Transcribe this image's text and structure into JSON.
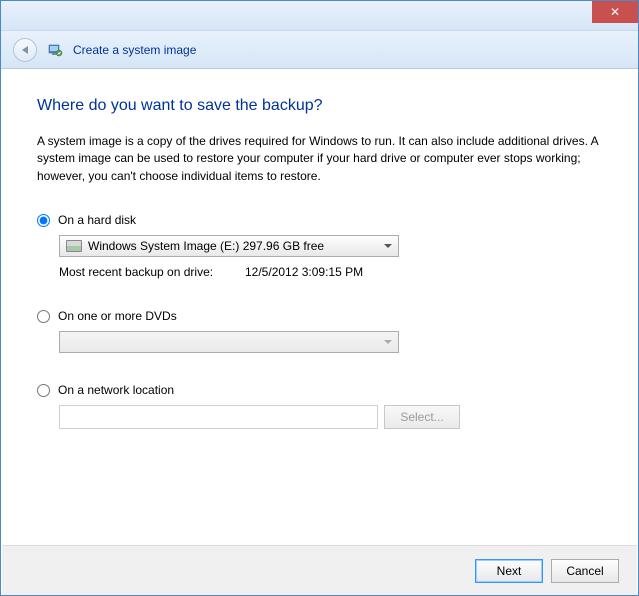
{
  "window": {
    "title": "Create a system image"
  },
  "main": {
    "heading": "Where do you want to save the backup?",
    "description": "A system image is a copy of the drives required for Windows to run. It can also include additional drives. A system image can be used to restore your computer if your hard drive or computer ever stops working; however, you can't choose individual items to restore."
  },
  "options": {
    "hard_disk": {
      "label": "On a hard disk",
      "selected_drive": "Windows System Image (E:)  297.96 GB free",
      "info_label": "Most recent backup on drive:",
      "info_value": "12/5/2012 3:09:15 PM"
    },
    "dvd": {
      "label": "On one or more DVDs"
    },
    "network": {
      "label": "On a network location",
      "select_btn": "Select..."
    }
  },
  "footer": {
    "next": "Next",
    "cancel": "Cancel"
  }
}
